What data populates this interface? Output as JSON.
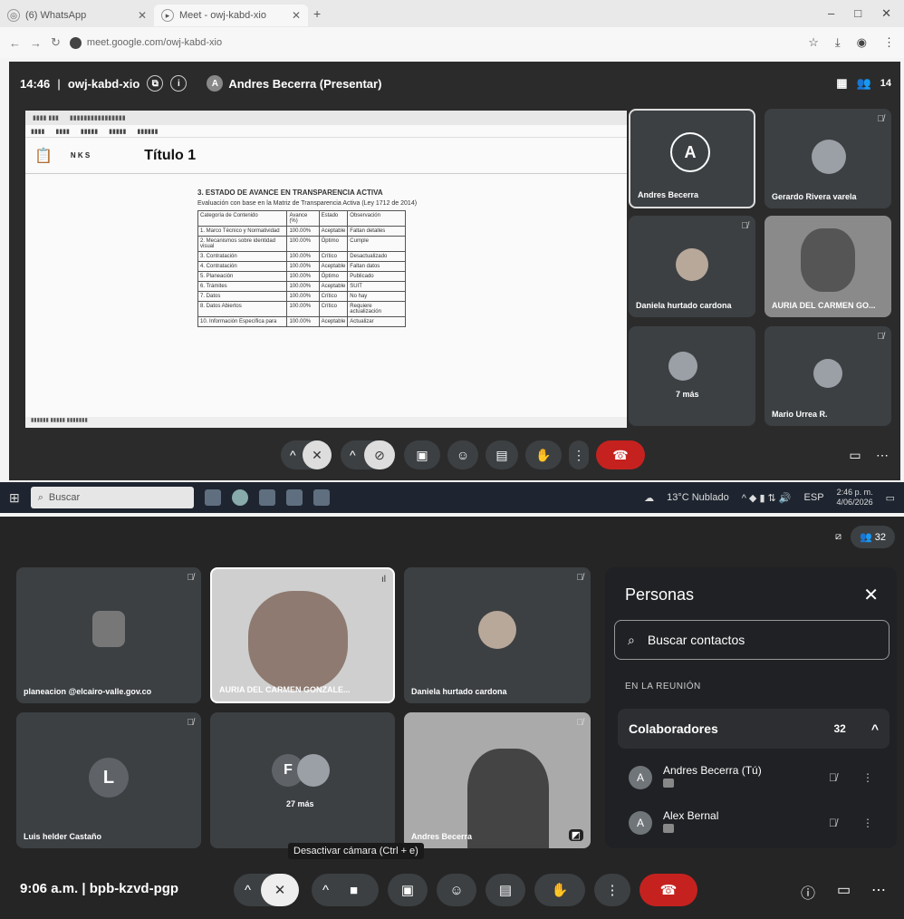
{
  "browser": {
    "tabs": [
      {
        "label": "(6) WhatsApp"
      },
      {
        "label": "Meet - owj-kabd-xio"
      }
    ],
    "new_tab": "+",
    "url": "meet.google.com/owj-kabd-xio"
  },
  "meeting1": {
    "time": "14:46",
    "code": "owj-kabd-xio",
    "presenter_initial": "A",
    "presenter": "Andres Becerra (Presentar)",
    "participant_count": "14",
    "document": {
      "ribbon_heading": "Título 1",
      "section_title": "3. ESTADO DE AVANCE EN TRANSPARENCIA ACTIVA",
      "section_subtitle": "Evaluación con base en la Matriz de Transparencia Activa (Ley 1712 de 2014)",
      "table_headers": [
        "Categoría de Contenido",
        "Avance (%)",
        "Estado",
        "Observación"
      ],
      "rows": [
        [
          "1. Marco Técnico y Normatividad",
          "100.00%",
          "Aceptable",
          "Faltan detalles"
        ],
        [
          "2. Mecanismos sobre identidad visual",
          "100.00%",
          "Óptimo",
          "Cumple"
        ],
        [
          "3. Contratación",
          "100.00%",
          "Crítico",
          "Desactualizado"
        ],
        [
          "4. Contratación",
          "100.00%",
          "Aceptable",
          "Faltan datos"
        ],
        [
          "5. Planeación",
          "100.00%",
          "Óptimo",
          "Publicado"
        ],
        [
          "6. Trámites",
          "100.00%",
          "Aceptable",
          "SUIT"
        ],
        [
          "7. Datos",
          "100.00%",
          "Crítico",
          "No hay"
        ],
        [
          "8. Datos Abiertos",
          "100.00%",
          "Crítico",
          "Requiere actualización"
        ],
        [
          "10. Información Específica para",
          "100.00%",
          "Aceptable",
          "Actualizar"
        ]
      ]
    },
    "tiles": [
      {
        "name": "Andres Becerra",
        "initial": "A"
      },
      {
        "name": "Gerardo Rivera varela"
      },
      {
        "name": "Daniela hurtado cardona"
      },
      {
        "name": "AURIA DEL CARMEN GO..."
      },
      {
        "name": "7 más"
      },
      {
        "name": "Mario Urrea R."
      }
    ]
  },
  "taskbar": {
    "search_placeholder": "Buscar",
    "weather": "13°C Nublado",
    "lang": "ESP",
    "time": "2:46 p. m.",
    "date": "4/06/2026"
  },
  "meeting2": {
    "participant_count": "32",
    "time": "9:06 a.m.",
    "code": "bpb-kzvd-pgp",
    "tooltip": "Desactivar cámara (Ctrl + e)",
    "tiles": [
      {
        "name": "planeacion @elcairo-valle.gov.co"
      },
      {
        "name": "AURIA DEL CARMEN GONZALE..."
      },
      {
        "name": "Daniela hurtado cardona"
      },
      {
        "name": "Luis helder Castaño",
        "initial": "L"
      },
      {
        "name": "27 más",
        "initial": "F"
      },
      {
        "name": "Andres Becerra"
      }
    ],
    "people_panel": {
      "title": "Personas",
      "search_placeholder": "Buscar contactos",
      "section": "EN LA REUNIÓN",
      "group_label": "Colaboradores",
      "group_count": "32",
      "people": [
        {
          "initial": "A",
          "name": "Andres Becerra (Tú)"
        },
        {
          "initial": "A",
          "name": "Alex Bernal"
        }
      ]
    }
  },
  "colors": {
    "meet_bg": "#2b2b2b",
    "tile_bg": "#3c4043",
    "end_call_red": "#c5221f"
  }
}
